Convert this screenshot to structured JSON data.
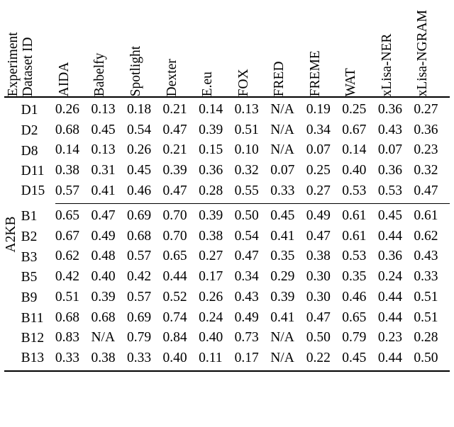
{
  "chart_data": {
    "type": "table",
    "title": "",
    "experiment": "A2KB",
    "row_headers": [
      "Experiment",
      "Dataset ID"
    ],
    "col_headers": [
      "AIDA",
      "Babelfy",
      "Spotlight",
      "Dexter",
      "E.eu",
      "FOX",
      "FRED",
      "FREME",
      "WAT",
      "xLisa-NER",
      "xLisa-NGRAM"
    ],
    "groups": [
      {
        "rows": [
          {
            "id": "D1",
            "values": [
              "0.26",
              "0.13",
              "0.18",
              "0.21",
              "0.14",
              "0.13",
              "N/A",
              "0.19",
              "0.25",
              "0.36",
              "0.27"
            ]
          },
          {
            "id": "D2",
            "values": [
              "0.68",
              "0.45",
              "0.54",
              "0.47",
              "0.39",
              "0.51",
              "N/A",
              "0.34",
              "0.67",
              "0.43",
              "0.36"
            ]
          },
          {
            "id": "D8",
            "values": [
              "0.14",
              "0.13",
              "0.26",
              "0.21",
              "0.15",
              "0.10",
              "N/A",
              "0.07",
              "0.14",
              "0.07",
              "0.23"
            ]
          },
          {
            "id": "D11",
            "values": [
              "0.38",
              "0.31",
              "0.45",
              "0.39",
              "0.36",
              "0.32",
              "0.07",
              "0.25",
              "0.40",
              "0.36",
              "0.32"
            ]
          },
          {
            "id": "D15",
            "values": [
              "0.57",
              "0.41",
              "0.46",
              "0.47",
              "0.28",
              "0.55",
              "0.33",
              "0.27",
              "0.53",
              "0.53",
              "0.47"
            ]
          }
        ]
      },
      {
        "rows": [
          {
            "id": "B1",
            "values": [
              "0.65",
              "0.47",
              "0.69",
              "0.70",
              "0.39",
              "0.50",
              "0.45",
              "0.49",
              "0.61",
              "0.45",
              "0.61"
            ]
          },
          {
            "id": "B2",
            "values": [
              "0.67",
              "0.49",
              "0.68",
              "0.70",
              "0.38",
              "0.54",
              "0.41",
              "0.47",
              "0.61",
              "0.44",
              "0.62"
            ]
          },
          {
            "id": "B3",
            "values": [
              "0.62",
              "0.48",
              "0.57",
              "0.65",
              "0.27",
              "0.47",
              "0.35",
              "0.38",
              "0.53",
              "0.36",
              "0.43"
            ]
          },
          {
            "id": "B5",
            "values": [
              "0.42",
              "0.40",
              "0.42",
              "0.44",
              "0.17",
              "0.34",
              "0.29",
              "0.30",
              "0.35",
              "0.24",
              "0.33"
            ]
          },
          {
            "id": "B9",
            "values": [
              "0.51",
              "0.39",
              "0.57",
              "0.52",
              "0.26",
              "0.43",
              "0.39",
              "0.30",
              "0.46",
              "0.44",
              "0.51"
            ]
          },
          {
            "id": "B11",
            "values": [
              "0.68",
              "0.68",
              "0.69",
              "0.74",
              "0.24",
              "0.49",
              "0.41",
              "0.47",
              "0.65",
              "0.44",
              "0.51"
            ]
          },
          {
            "id": "B12",
            "values": [
              "0.83",
              "N/A",
              "0.79",
              "0.84",
              "0.40",
              "0.73",
              "N/A",
              "0.50",
              "0.79",
              "0.23",
              "0.28"
            ]
          },
          {
            "id": "B13",
            "values": [
              "0.33",
              "0.38",
              "0.33",
              "0.40",
              "0.11",
              "0.17",
              "N/A",
              "0.22",
              "0.45",
              "0.44",
              "0.50"
            ]
          }
        ]
      }
    ]
  }
}
